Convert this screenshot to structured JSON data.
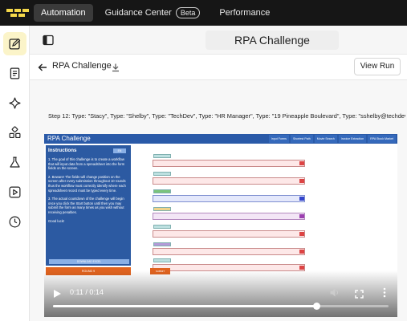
{
  "nav": {
    "items": [
      {
        "label": "Automation",
        "active": true
      },
      {
        "label": "Guidance Center",
        "badge": "Beta"
      },
      {
        "label": "Performance"
      }
    ]
  },
  "sidebar": {
    "items": [
      {
        "icon": "edit-icon",
        "active": true
      },
      {
        "icon": "document-icon"
      },
      {
        "icon": "sparkle-icon"
      },
      {
        "icon": "components-icon"
      },
      {
        "icon": "flask-icon"
      },
      {
        "icon": "video-play-icon"
      },
      {
        "icon": "clock-icon"
      }
    ]
  },
  "header": {
    "title": "RPA Challenge"
  },
  "run": {
    "title": "RPA Challenge",
    "view_run_label": "View Run"
  },
  "step": {
    "text": "Step 12: Type: \"Stacy\", Type: \"Shelby\", Type: \"TechDev\", Type: \"HR Manager\", Type: \"19 Pineapple Boulevard\", Type: \"sshelby@techdev.co..."
  },
  "video": {
    "app_title": "RPA Challenge",
    "tabs": [
      "Input Forms",
      "Shortest Path",
      "Movie Search",
      "Invoice Extraction",
      "RPA Stock Market"
    ],
    "instructions": {
      "title": "Instructions",
      "paragraphs": [
        "1. The goal of this challenge is to create a workflow that will input data from a spreadsheet into the form fields on the screen.",
        "2. Beware! The fields will change position on the screen after every submission throughout 10 rounds thus the workflow must correctly identify where each spreadsheet record must be typed every time.",
        "3. The actual countdown of the challenge will begin once you click the Start button until then you may submit the form as many times as you wish without receiving penalties.",
        "Good luck!"
      ],
      "download_label": "DOWNLOAD EXCEL",
      "start_label": "ROUND 9"
    },
    "submit_label": "SUBMIT",
    "time": "0:11 / 0:14",
    "progress": 0.786
  }
}
